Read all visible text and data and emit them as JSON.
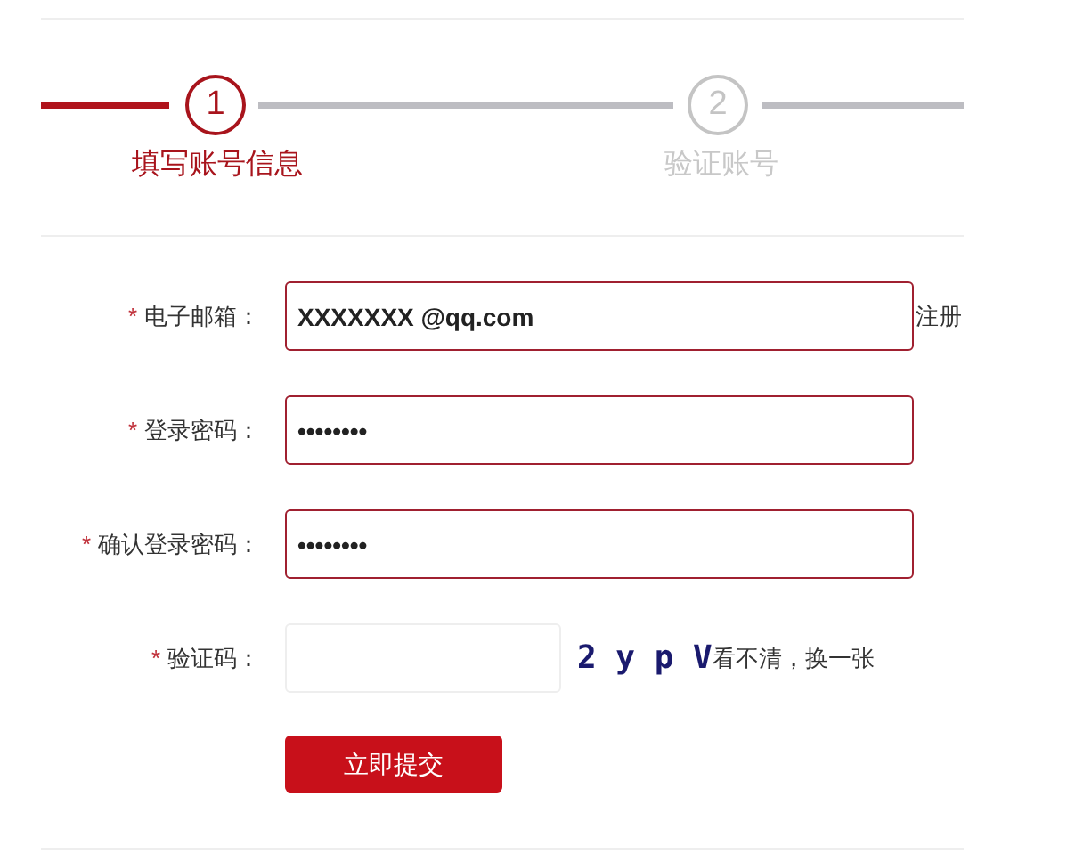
{
  "steps": [
    {
      "number": "1",
      "label": "填写账号信息",
      "selected": true
    },
    {
      "number": "2",
      "label": "验证账号",
      "selected": false
    }
  ],
  "fields": [
    {
      "kind": "text",
      "required_mark": "*",
      "label": "电子邮箱：",
      "value": "XXXXXXX @qq.com",
      "highlighted": true,
      "side_link": "注册"
    },
    {
      "kind": "text",
      "required_mark": "*",
      "label": "登录密码：",
      "value": "••••••••",
      "highlighted": true
    },
    {
      "kind": "text",
      "required_mark": "*",
      "label": "确认登录密码：",
      "value": "••••••••",
      "highlighted": true
    },
    {
      "kind": "captcha",
      "required_mark": "*",
      "label": "验证码：",
      "highlighted": false,
      "captcha": "2 y p V",
      "refresh_link": "看不清，换一张"
    }
  ],
  "submit_button": "立即提交"
}
